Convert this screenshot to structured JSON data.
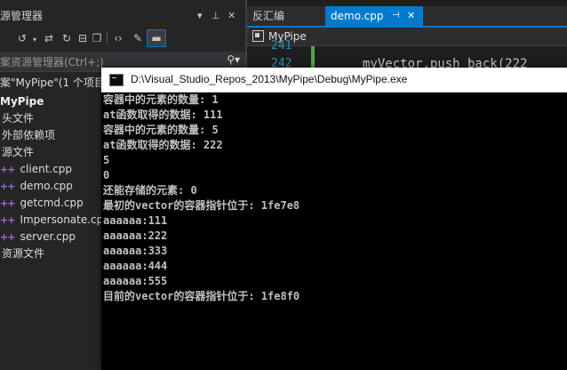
{
  "solution_explorer": {
    "title": "源管理器",
    "title_icons": [
      "dropdown-icon",
      "pin-icon",
      "close-icon"
    ],
    "search_placeholder": "案资源管理器(Ctrl+;)",
    "tree": [
      {
        "label": "案\"MyPipe\"(1 个项目",
        "kind": "solution"
      },
      {
        "label": "MyPipe",
        "kind": "project"
      },
      {
        "label": "头文件",
        "kind": "folder"
      },
      {
        "label": "外部依赖项",
        "kind": "folder"
      },
      {
        "label": "源文件",
        "kind": "folder"
      },
      {
        "label": "client.cpp",
        "kind": "cpp-file"
      },
      {
        "label": "demo.cpp",
        "kind": "cpp-file"
      },
      {
        "label": "getcmd.cpp",
        "kind": "cpp-file"
      },
      {
        "label": "Impersonate.cpp",
        "kind": "cpp-file"
      },
      {
        "label": "server.cpp",
        "kind": "cpp-file"
      },
      {
        "label": "资源文件",
        "kind": "folder"
      }
    ]
  },
  "editor": {
    "tabs": [
      {
        "label": "反汇编",
        "active": false
      },
      {
        "label": "demo.cpp",
        "active": true
      }
    ],
    "nav_scope": "MyPipe",
    "line_numbers": [
      "241",
      "242"
    ],
    "code_fragment": "myVector.push_back(222"
  },
  "console": {
    "title": "D:\\Visual_Studio_Repos_2013\\MyPipe\\Debug\\MyPipe.exe",
    "lines": [
      "容器中的元素的数量: 1",
      "at函数取得的数据: 111",
      "容器中的元素的数量: 5",
      "at函数取得的数据: 222",
      "5",
      "0",
      "还能存储的元素: 0",
      "最初的vector的容器指针位于: 1fe7e8",
      "aaaaaa:111",
      "aaaaaa:222",
      "aaaaaa:333",
      "aaaaaa:444",
      "aaaaaa:555",
      "目前的vector的容器指针位于: 1fe8f0"
    ]
  },
  "colors": {
    "accent": "#007acc",
    "ide_background": "#2d2d30",
    "console_background": "#000000",
    "console_text": "#c0c0c0",
    "cpp_icon": "#9b6bd6"
  }
}
